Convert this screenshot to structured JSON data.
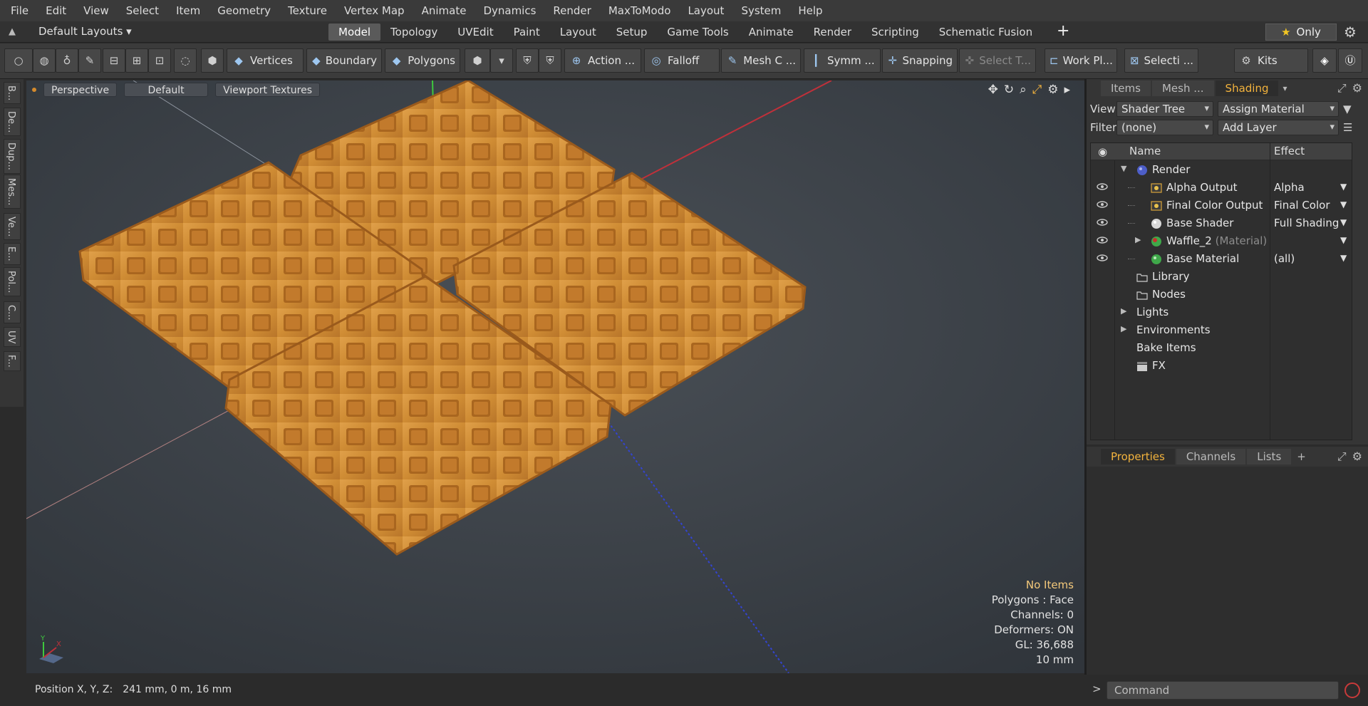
{
  "menu": [
    "File",
    "Edit",
    "View",
    "Select",
    "Item",
    "Geometry",
    "Texture",
    "Vertex Map",
    "Animate",
    "Dynamics",
    "Render",
    "MaxToModo",
    "Layout",
    "System",
    "Help"
  ],
  "layout_selector": "Default Layouts",
  "layout_tabs": [
    "Model",
    "Topology",
    "UVEdit",
    "Paint",
    "Layout",
    "Setup",
    "Game Tools",
    "Animate",
    "Render",
    "Scripting",
    "Schematic Fusion"
  ],
  "active_layout_tab": "Model",
  "only_button": "Only",
  "toolbar": {
    "vertices": "Vertices",
    "boundary": "Boundary",
    "polygons": "Polygons",
    "action": "Action ...",
    "falloff": "Falloff",
    "mesh_c": "Mesh C ...",
    "symm": "Symm ...",
    "snapping": "Snapping",
    "select_t": "Select T...",
    "work_pl": "Work Pl...",
    "selecti": "Selecti ...",
    "kits": "Kits"
  },
  "left_tabs": [
    "B...",
    "De...",
    "Dup...",
    "Mes...",
    "Ve...",
    "E...",
    "Pol...",
    "C...",
    "UV",
    "F..."
  ],
  "viewport": {
    "perspective": "Perspective",
    "default": "Default",
    "viewport_textures": "Viewport Textures",
    "info": {
      "no_items": "No Items",
      "polygons": "Polygons : Face",
      "channels": "Channels: 0",
      "deformers": "Deformers: ON",
      "gl": "GL: 36,688",
      "scale": "10 mm"
    },
    "axis_x": "X",
    "axis_y": "Y"
  },
  "status": {
    "label": "Position X, Y, Z:",
    "value": "241 mm, 0 m, 16 mm"
  },
  "right_panel": {
    "tabs": [
      "Items",
      "Mesh ...",
      "Shading"
    ],
    "active_tab": "Shading",
    "view_label": "View",
    "view_value": "Shader Tree",
    "assign_material": "Assign Material",
    "filter_label": "Filter",
    "filter_value": "(none)",
    "add_layer": "Add Layer",
    "col_name": "Name",
    "col_effect": "Effect",
    "tree": [
      {
        "name": "Render",
        "effect": ""
      },
      {
        "name": "Alpha Output",
        "effect": "Alpha"
      },
      {
        "name": "Final Color Output",
        "effect": "Final Color"
      },
      {
        "name": "Base Shader",
        "effect": "Full Shading"
      },
      {
        "name": "Waffle_2",
        "sub": "(Material)",
        "effect": ""
      },
      {
        "name": "Base Material",
        "effect": "(all)"
      },
      {
        "name": "Library",
        "effect": ""
      },
      {
        "name": "Nodes",
        "effect": ""
      },
      {
        "name": "Lights",
        "effect": ""
      },
      {
        "name": "Environments",
        "effect": ""
      },
      {
        "name": "Bake Items",
        "effect": ""
      },
      {
        "name": "FX",
        "effect": ""
      }
    ]
  },
  "bottom_panel": {
    "tabs": [
      "Properties",
      "Channels",
      "Lists"
    ],
    "active_tab": "Properties"
  },
  "command": {
    "prompt": ">",
    "placeholder": "Command"
  },
  "colors": {
    "accent": "#f3b33d",
    "waffle": "#d4913b",
    "axis_x": "#c0303a",
    "axis_y": "#3ec83e",
    "axis_z": "#3344d0"
  }
}
